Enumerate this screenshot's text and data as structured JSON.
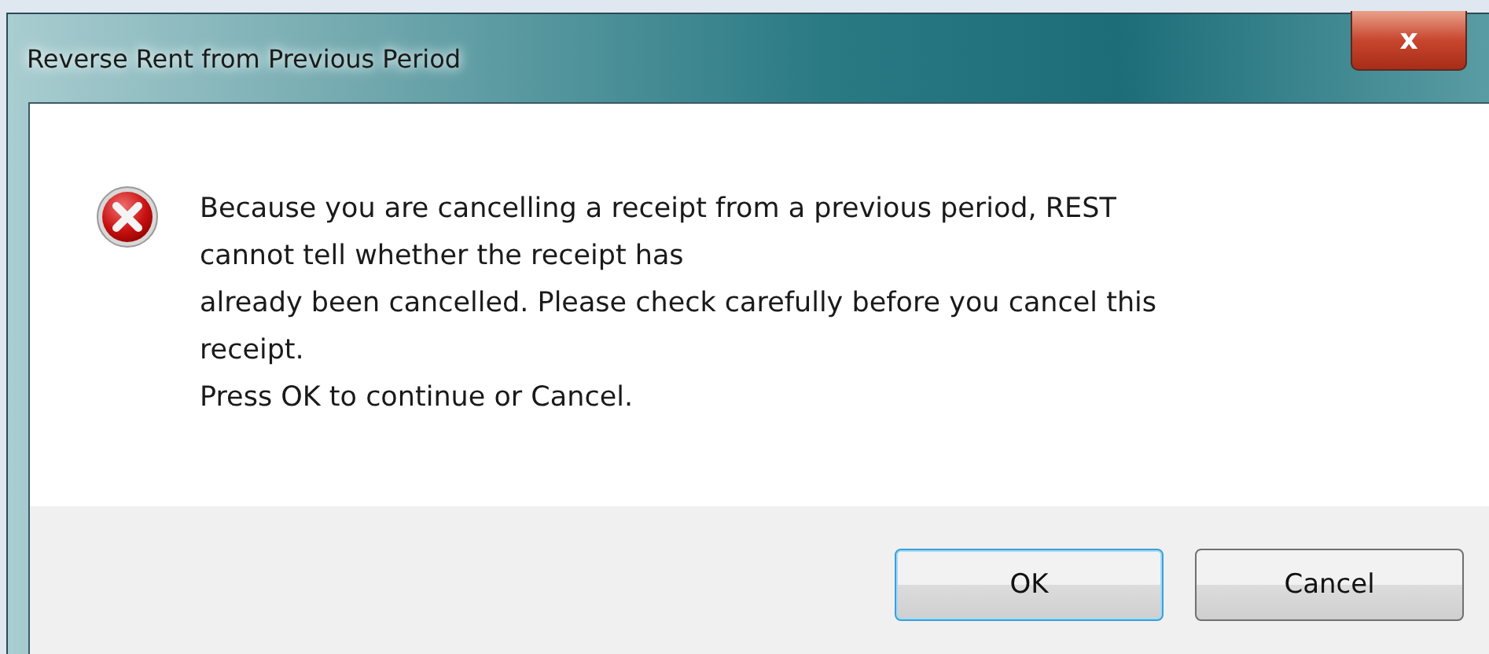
{
  "window": {
    "title": "Reverse Rent from Previous Period",
    "close": "x"
  },
  "message": {
    "kind": "error",
    "lines": [
      "Because you are cancelling a receipt from a previous period, REST",
      "cannot tell whether the receipt has",
      "already been cancelled. Please check carefully before you cancel this",
      "receipt.",
      "Press OK to continue or Cancel."
    ]
  },
  "buttons": [
    {
      "label": "OK",
      "default": true
    },
    {
      "label": "Cancel",
      "default": false
    }
  ]
}
